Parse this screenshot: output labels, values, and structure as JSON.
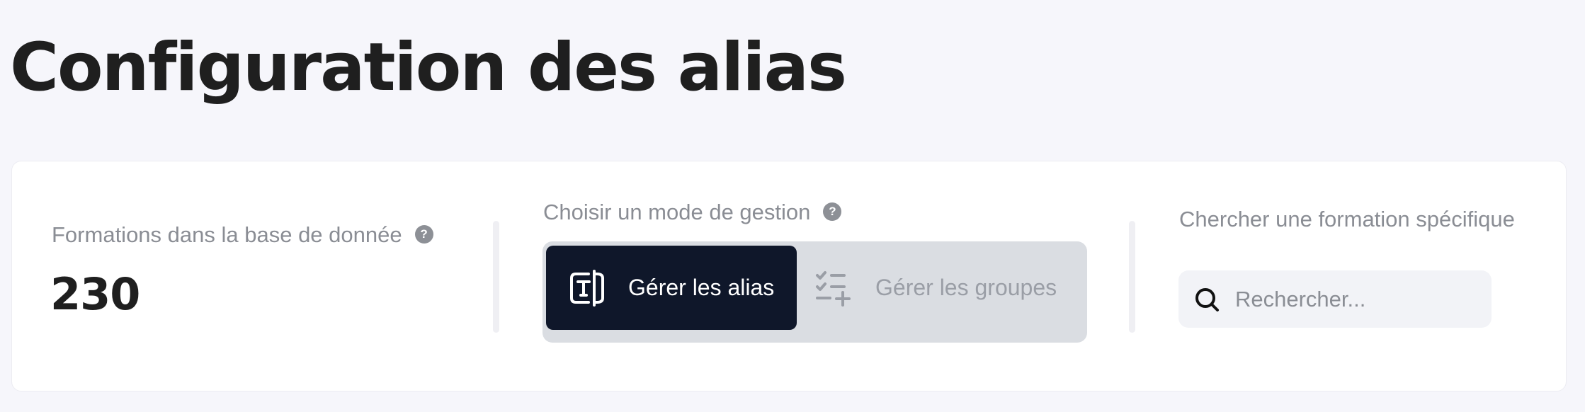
{
  "page": {
    "title": "Configuration des alias"
  },
  "stats": {
    "label": "Formations dans la base de donnée",
    "value": "230",
    "help": "?"
  },
  "mode": {
    "label": "Choisir un mode de gestion",
    "help": "?",
    "options": [
      {
        "label": "Gérer les alias",
        "icon": "text-alias-icon",
        "selected": true
      },
      {
        "label": "Gérer les groupes",
        "icon": "checklist-add-icon",
        "selected": false
      }
    ]
  },
  "search": {
    "label": "Chercher une formation spécifique",
    "placeholder": "Rechercher...",
    "value": "",
    "icon": "search-icon"
  },
  "colors": {
    "background": "#f6f6fb",
    "active_button": "#0f172a",
    "segmented_bg": "#dadde2",
    "muted_text": "#8a8d94"
  }
}
